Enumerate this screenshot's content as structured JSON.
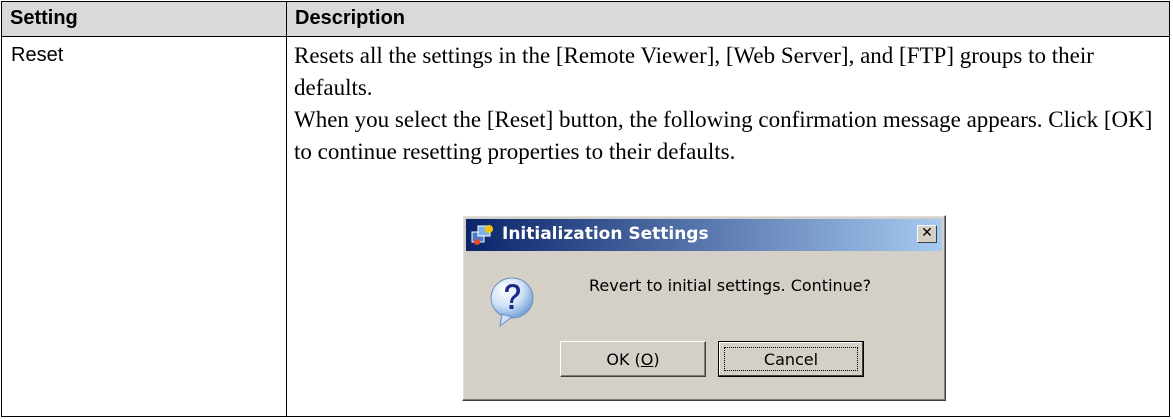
{
  "table": {
    "headers": [
      "Setting",
      "Description"
    ],
    "row": {
      "setting": "Reset",
      "description": [
        "Resets all the settings in the [Remote Viewer], [Web Server], and [FTP] groups to their defaults.",
        "When you select the [Reset] button, the following confirmation message appears. Click [OK] to continue resetting properties to their defaults."
      ]
    }
  },
  "dialog": {
    "title": "Initialization Settings",
    "icon": "question-icon",
    "app_icon": "app-icon",
    "close_glyph": "✕",
    "message": "Revert to initial settings. Continue?",
    "ok_label_prefix": "OK (",
    "ok_label_mnemonic": "O",
    "ok_label_suffix": ")",
    "cancel_label": "Cancel"
  }
}
